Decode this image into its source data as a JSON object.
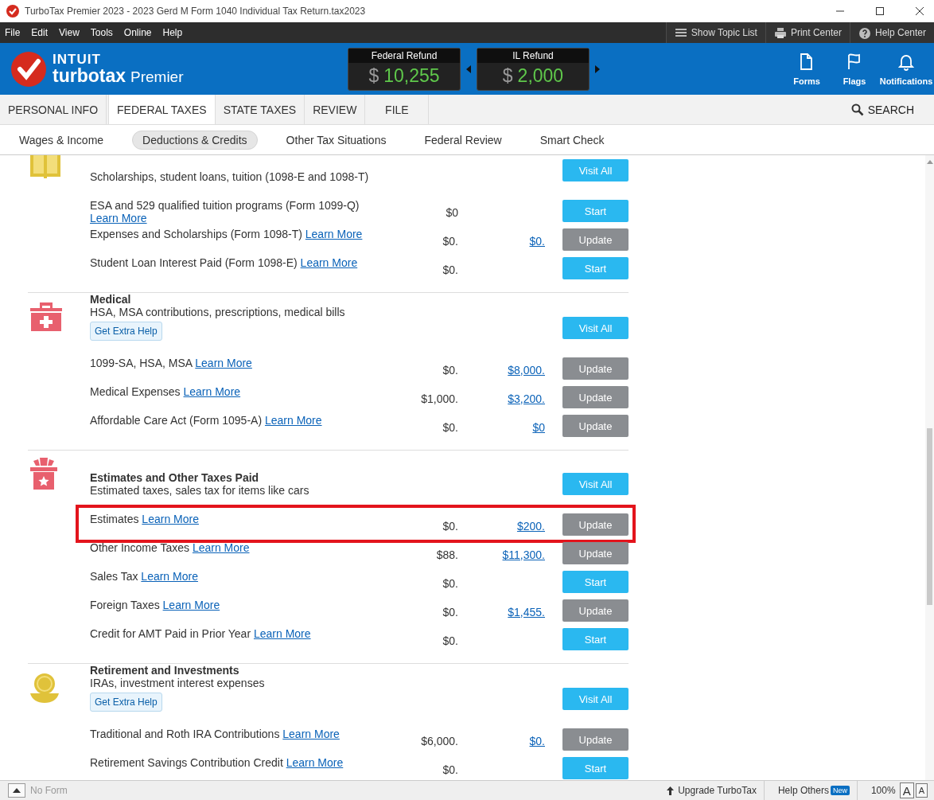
{
  "window": {
    "title": "TurboTax Premier 2023 - 2023 Gerd M Form 1040  Individual Tax Return.tax2023"
  },
  "menu": [
    "File",
    "Edit",
    "View",
    "Tools",
    "Online",
    "Help"
  ],
  "toolbar": [
    {
      "label": "Show Topic List",
      "kind": "list"
    },
    {
      "label": "Print Center",
      "kind": "print"
    },
    {
      "label": "Help Center",
      "kind": "help"
    }
  ],
  "brand": {
    "company": "INTUIT",
    "product": "turbotax",
    "edition": "Premier"
  },
  "refunds": [
    {
      "label": "Federal Refund",
      "currency": "$",
      "amount": "10,255"
    },
    {
      "label": "IL Refund",
      "currency": "$",
      "amount": "2,000"
    }
  ],
  "header_actions": [
    {
      "label": "Forms",
      "kind": "forms"
    },
    {
      "label": "Flags",
      "kind": "flags"
    },
    {
      "label": "Notifications",
      "kind": "notifications"
    }
  ],
  "tabs": [
    {
      "label": "PERSONAL INFO",
      "selected": false
    },
    {
      "label": "FEDERAL TAXES",
      "selected": true
    },
    {
      "label": "STATE TAXES",
      "selected": false
    },
    {
      "label": "REVIEW",
      "selected": false
    },
    {
      "label": "FILE",
      "selected": false
    }
  ],
  "search": {
    "label": "SEARCH"
  },
  "subnav": [
    {
      "label": "Wages & Income",
      "selected": false
    },
    {
      "label": "Deductions & Credits",
      "selected": true
    },
    {
      "label": "Other Tax Situations",
      "selected": false
    },
    {
      "label": "Federal Review",
      "selected": false
    },
    {
      "label": "Smart Check",
      "selected": false
    }
  ],
  "sections": [
    {
      "kind": "education",
      "description": "Scholarships, student loans, tuition (1098-E and 1098-T)",
      "visit_all": "Visit All",
      "items": [
        {
          "label": "ESA and 529 qualified tuition programs (Form 1099-Q)",
          "link": "Learn More",
          "prior": "$0",
          "button": "Start",
          "kind": "start",
          "highlighted": false
        },
        {
          "label": "Expenses and Scholarships (Form 1098-T)",
          "link": "Learn More",
          "prior": "$0.",
          "current": "$0.",
          "button": "Update",
          "kind": "update",
          "highlighted": false
        },
        {
          "label": "Student Loan Interest Paid (Form 1098-E)",
          "link": "Learn More",
          "prior": "$0.",
          "button": "Start",
          "kind": "start",
          "highlighted": false
        }
      ]
    },
    {
      "kind": "medical",
      "title": "Medical",
      "description": "HSA, MSA contributions, prescriptions, medical bills",
      "extra_help": "Get Extra Help",
      "visit_all": "Visit All",
      "items": [
        {
          "label": "1099-SA, HSA, MSA",
          "link": "Learn More",
          "prior": "$0.",
          "current": "$8,000.",
          "button": "Update",
          "kind": "update",
          "highlighted": false
        },
        {
          "label": "Medical Expenses",
          "link": "Learn More",
          "prior": "$1,000.",
          "current": "$3,200.",
          "button": "Update",
          "kind": "update",
          "highlighted": false
        },
        {
          "label": "Affordable Care Act (Form 1095-A)",
          "link": "Learn More",
          "prior": "$0.",
          "current": "$0",
          "button": "Update",
          "kind": "update",
          "highlighted": false
        }
      ]
    },
    {
      "kind": "estimates",
      "title": "Estimates and Other Taxes Paid",
      "description": "Estimated taxes, sales tax for items like cars",
      "visit_all": "Visit All",
      "items": [
        {
          "label": "Estimates",
          "link": "Learn More",
          "prior": "$0.",
          "current": "$200.",
          "button": "Update",
          "kind": "update",
          "highlighted": true
        },
        {
          "label": "Other Income Taxes",
          "link": "Learn More",
          "prior": "$88.",
          "current": "$11,300.",
          "button": "Update",
          "kind": "update",
          "highlighted": false
        },
        {
          "label": "Sales Tax",
          "link": "Learn More",
          "prior": "$0.",
          "button": "Start",
          "kind": "start",
          "highlighted": false
        },
        {
          "label": "Foreign Taxes",
          "link": "Learn More",
          "prior": "$0.",
          "current": "$1,455.",
          "button": "Update",
          "kind": "update",
          "highlighted": false
        },
        {
          "label": "Credit for AMT Paid in Prior Year",
          "link": "Learn More",
          "prior": "$0.",
          "button": "Start",
          "kind": "start",
          "highlighted": false
        }
      ]
    },
    {
      "kind": "retirement",
      "title": "Retirement and Investments",
      "description": "IRAs, investment interest expenses",
      "extra_help": "Get Extra Help",
      "visit_all": "Visit All",
      "items": [
        {
          "label": "Traditional and Roth IRA Contributions",
          "link": "Learn More",
          "prior": "$6,000.",
          "current": "$0.",
          "button": "Update",
          "kind": "update",
          "highlighted": false
        },
        {
          "label": "Retirement Savings Contribution Credit",
          "link": "Learn More",
          "prior": "$0.",
          "button": "Start",
          "kind": "start",
          "highlighted": false
        }
      ]
    }
  ],
  "status_bar": {
    "form": "No Form",
    "upgrade": "Upgrade TurboTax",
    "help_others": "Help Others",
    "badge": "New",
    "zoom": "100%",
    "font_buttons": [
      "A",
      "A"
    ]
  }
}
